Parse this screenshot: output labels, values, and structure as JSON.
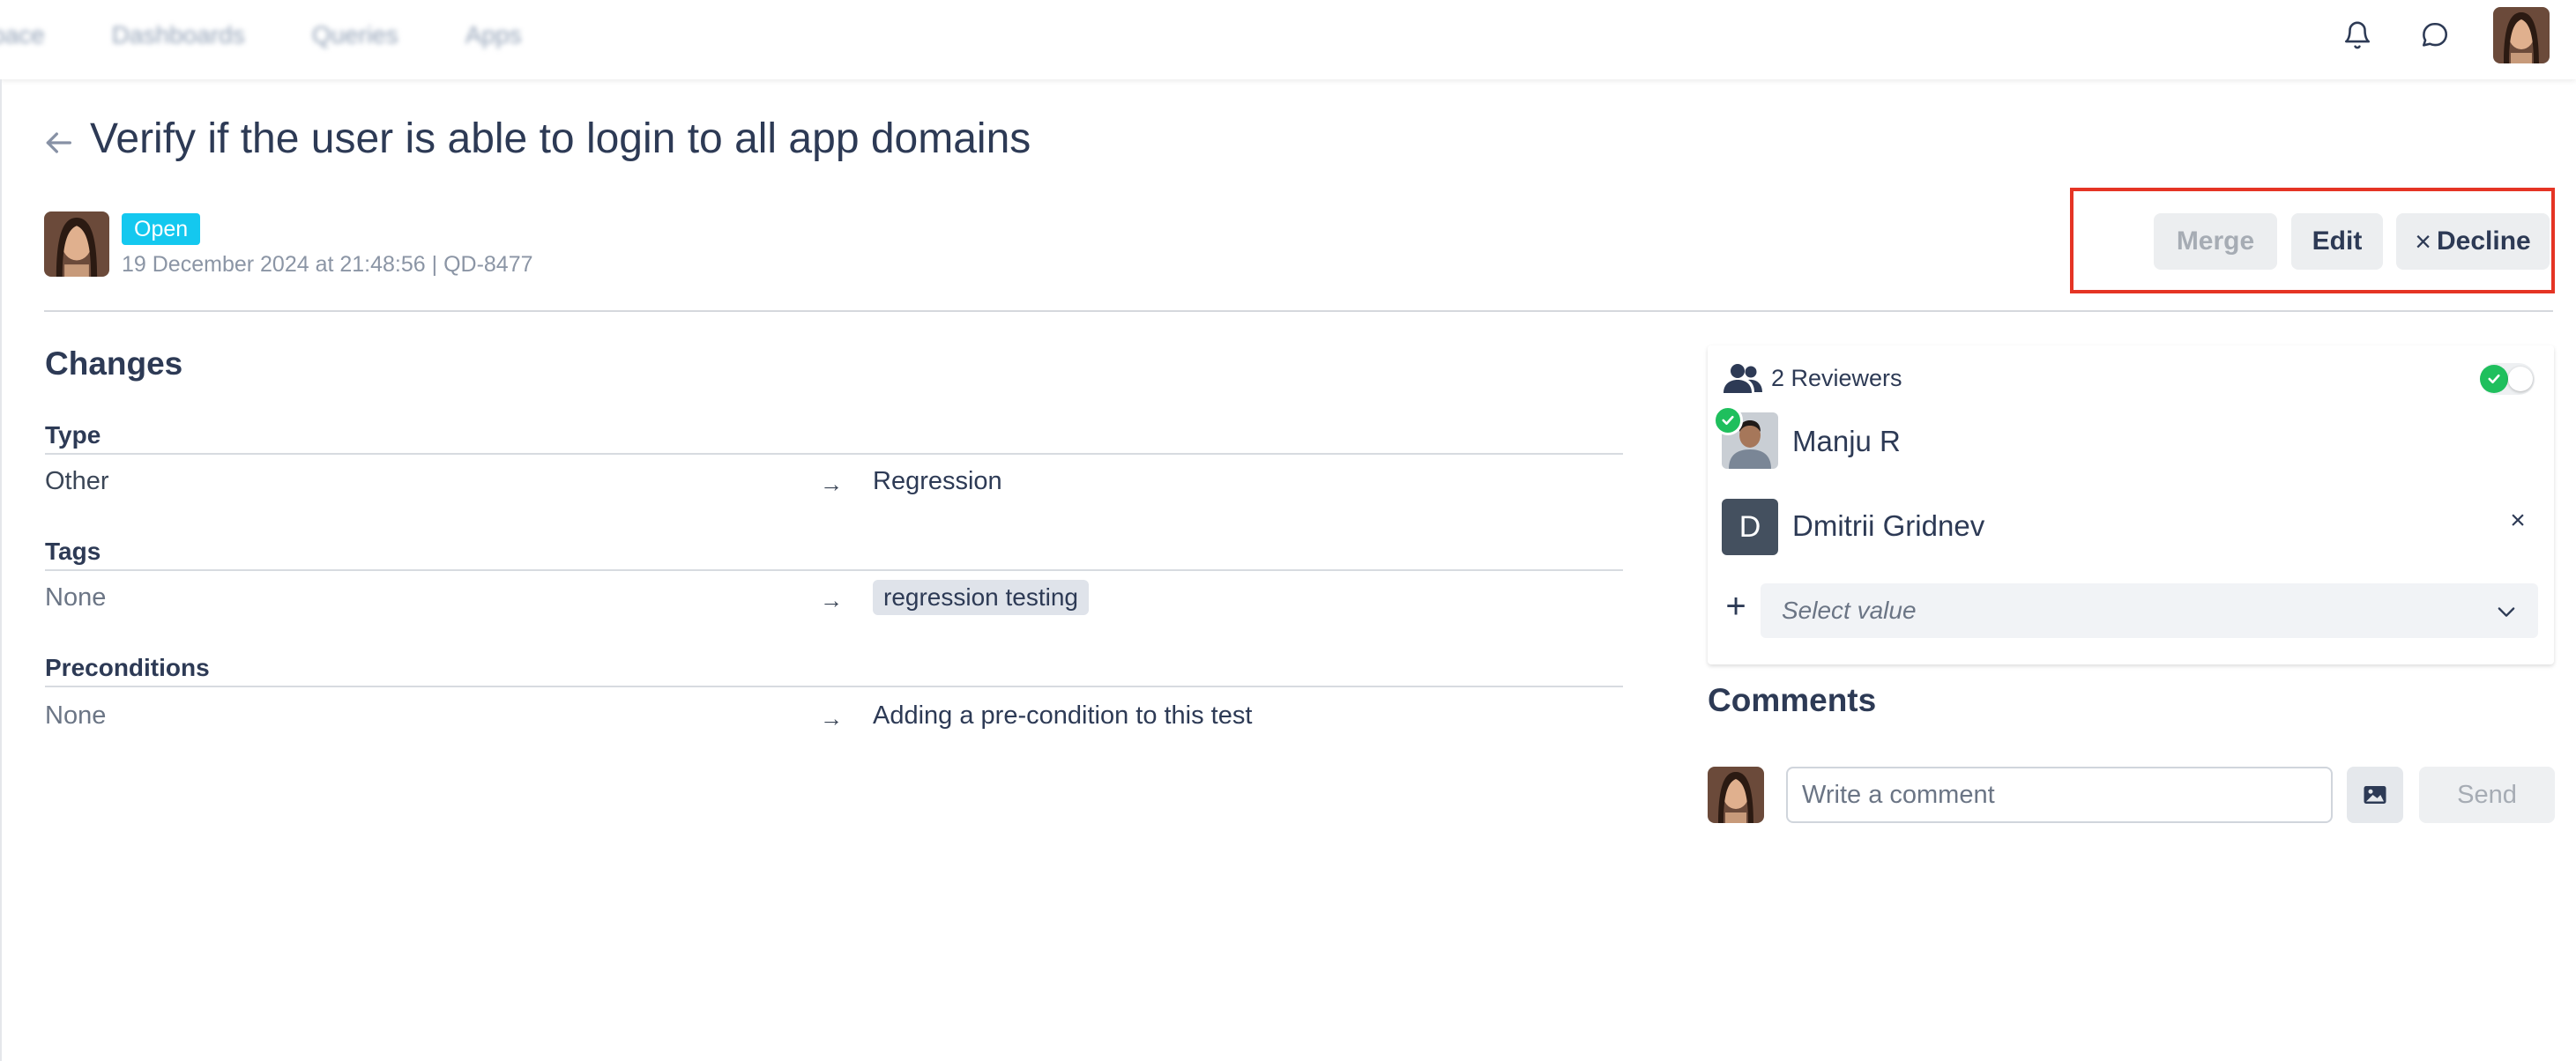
{
  "nav": {
    "links": [
      "pace",
      "Dashboards",
      "Queries",
      "Apps"
    ]
  },
  "header_icons": [
    "bell-icon",
    "chat-bubble-icon",
    "user-avatar"
  ],
  "page": {
    "title": "Verify if the user is able to login to all app domains",
    "status": "Open",
    "meta": "19 December 2024 at 21:48:56 | QD-8477"
  },
  "actions": {
    "merge": "Merge",
    "edit": "Edit",
    "decline_icon": "×",
    "decline": "Decline"
  },
  "changes": {
    "title": "Changes",
    "fields": [
      {
        "label": "Type",
        "old": "Other",
        "new": "Regression"
      },
      {
        "label": "Tags",
        "old": "None",
        "new": "regression testing"
      },
      {
        "label": "Preconditions",
        "old": "None",
        "new": "Adding a pre-condition to this test"
      }
    ],
    "arrow": "→"
  },
  "reviewers": {
    "count_label": "2 Reviewers",
    "list": [
      {
        "name": "Manju R",
        "approved": true
      },
      {
        "name": "Dmitrii Gridnev",
        "initial": "D"
      }
    ],
    "remove_glyph": "×",
    "add_glyph": "+",
    "select_placeholder": "Select value"
  },
  "comments": {
    "title": "Comments",
    "placeholder": "Write a comment",
    "send": "Send"
  },
  "colors": {
    "status_badge": "#14c8ef",
    "approved_green": "#1fbf5d",
    "highlight_red": "#e53424",
    "text_dark": "#2d3a55"
  }
}
